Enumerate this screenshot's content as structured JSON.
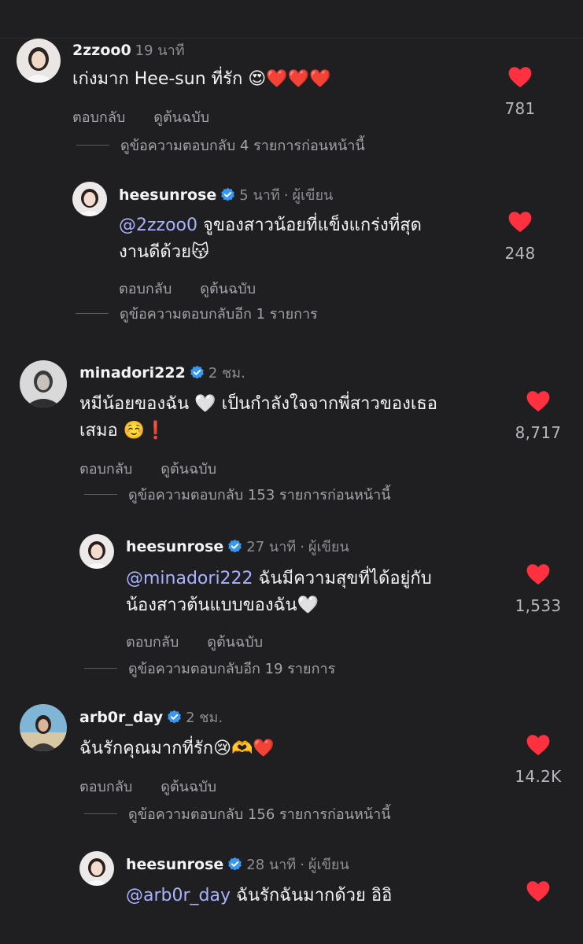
{
  "actions": {
    "reply": "ตอบกลับ",
    "see_original": "ดูต้นฉบับ"
  },
  "author_label": "ผู้เขียน",
  "colors": {
    "like": "#ff3040",
    "verified": "#3897f0",
    "mention": "#a9b2ff",
    "background": "#1f1f22"
  },
  "comments": [
    {
      "username": "2zzoo0",
      "time": "19 นาที",
      "verified": false,
      "text_line1": "เก่งมาก Hee-sun ที่รัก",
      "emojis": "😍❤️❤️❤️",
      "likes": "781",
      "view_replies": "ดูข้อความตอบกลับ 4 รายการก่อนหน้านี้",
      "avatar_icon": "profile-photo-icon"
    },
    {
      "username": "heesunrose",
      "time": "5 นาที",
      "verified": true,
      "mention": "@2zzoo0",
      "text_line1": "จูของสาวน้อยที่แข็งแกร่งที่สุด",
      "text_line2": "งานดีด้วย",
      "emojis": "😽",
      "likes": "248",
      "view_replies": "ดูข้อความตอบกลับอีก 1 รายการ",
      "avatar_icon": "profile-photo-icon"
    },
    {
      "username": "minadori222",
      "time": "2 ชม.",
      "verified": true,
      "text_line1": "หมีน้อยของฉัน",
      "emoji_mid": "🤍",
      "text_line1b": "เป็นกำลังใจจากพี่สาวของเธอ",
      "text_line2": "เสมอ",
      "emojis": "☺️❗",
      "likes": "8,717",
      "view_replies": "ดูข้อความตอบกลับ 153 รายการก่อนหน้านี้",
      "avatar_icon": "profile-photo-icon"
    },
    {
      "username": "heesunrose",
      "time": "27 นาที",
      "verified": true,
      "mention": "@minadori222",
      "text_line1": "ฉันมีความสุขที่ได้อยู่กับ",
      "text_line2": "น้องสาวต้นแบบของฉัน",
      "emojis": "🤍",
      "likes": "1,533",
      "view_replies": "ดูข้อความตอบกลับอีก 19 รายการ",
      "avatar_icon": "profile-photo-icon"
    },
    {
      "username": "arb0r_day",
      "time": "2 ชม.",
      "verified": true,
      "text_line1": "ฉันรักคุณมากที่รัก",
      "emojis": "😢🫶❤️",
      "likes": "14.2K",
      "view_replies": "ดูข้อความตอบกลับ 156 รายการก่อนหน้านี้",
      "avatar_icon": "profile-photo-icon"
    },
    {
      "username": "heesunrose",
      "time": "28 นาที",
      "verified": true,
      "mention": "@arb0r_day",
      "text_line1": "ฉันรักฉันมากด้วย อิอิ",
      "avatar_icon": "profile-photo-icon"
    }
  ]
}
